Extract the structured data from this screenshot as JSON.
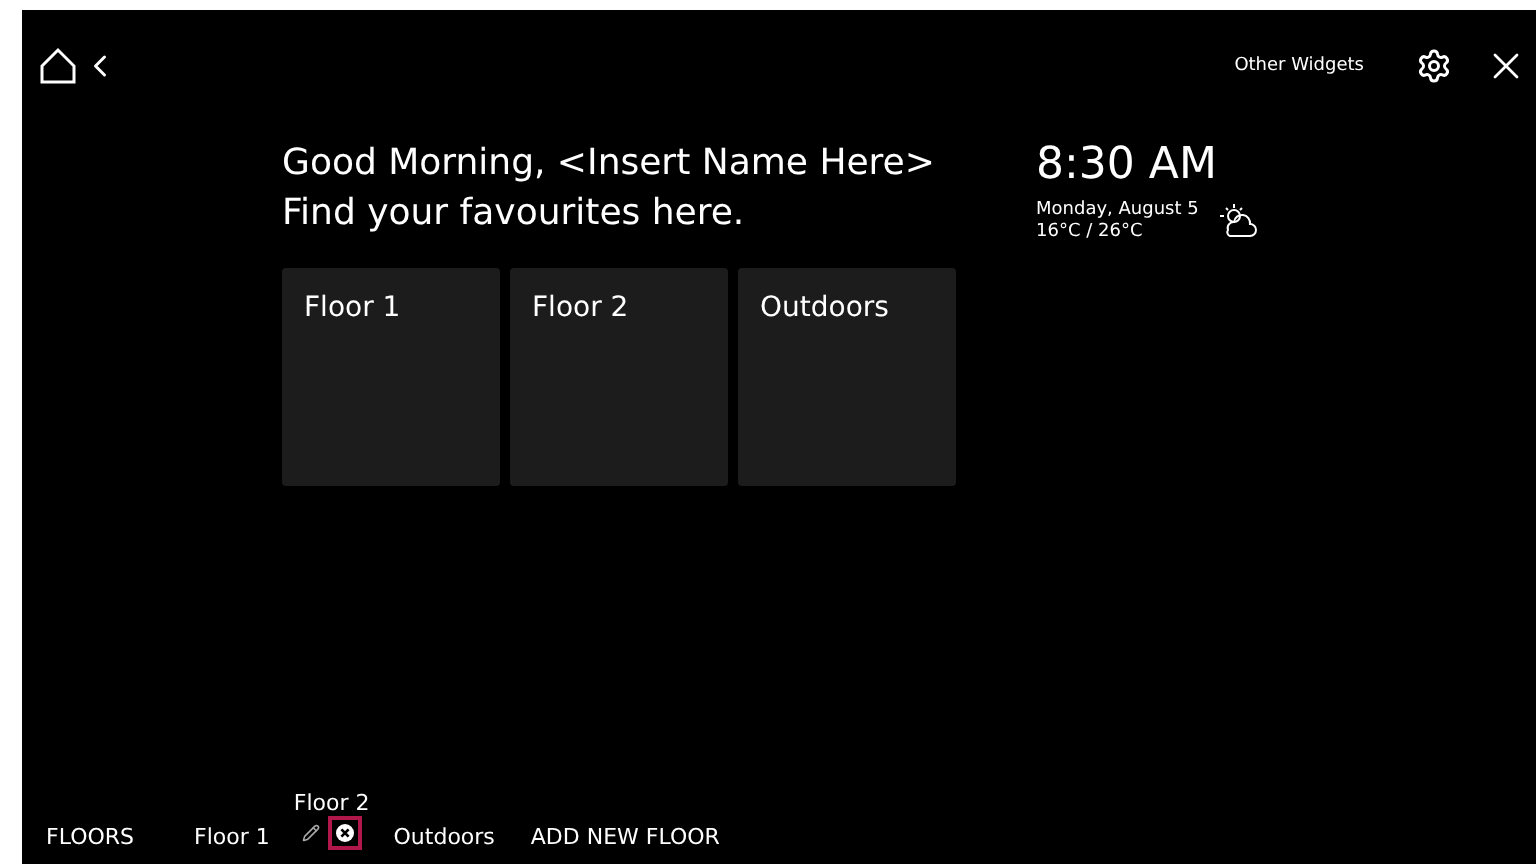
{
  "header": {
    "other_widgets": "Other Widgets"
  },
  "greeting": {
    "line_1": "Good Morning, <Insert Name Here>",
    "line_2": "Find your favourites here."
  },
  "clock": {
    "time": "8:30 AM",
    "date": "Monday, August 5",
    "temperature": "16°C / 26°C"
  },
  "cards": [
    {
      "label": "Floor 1"
    },
    {
      "label": "Floor 2"
    },
    {
      "label": "Outdoors"
    }
  ],
  "floor_bar": {
    "title": "FLOORS",
    "floors": [
      {
        "label": "Floor 1",
        "editing": false
      },
      {
        "label": "Floor 2",
        "editing": true
      },
      {
        "label": "Outdoors",
        "editing": false
      }
    ],
    "delete_focused": true,
    "add_label": "ADD NEW FLOOR"
  }
}
